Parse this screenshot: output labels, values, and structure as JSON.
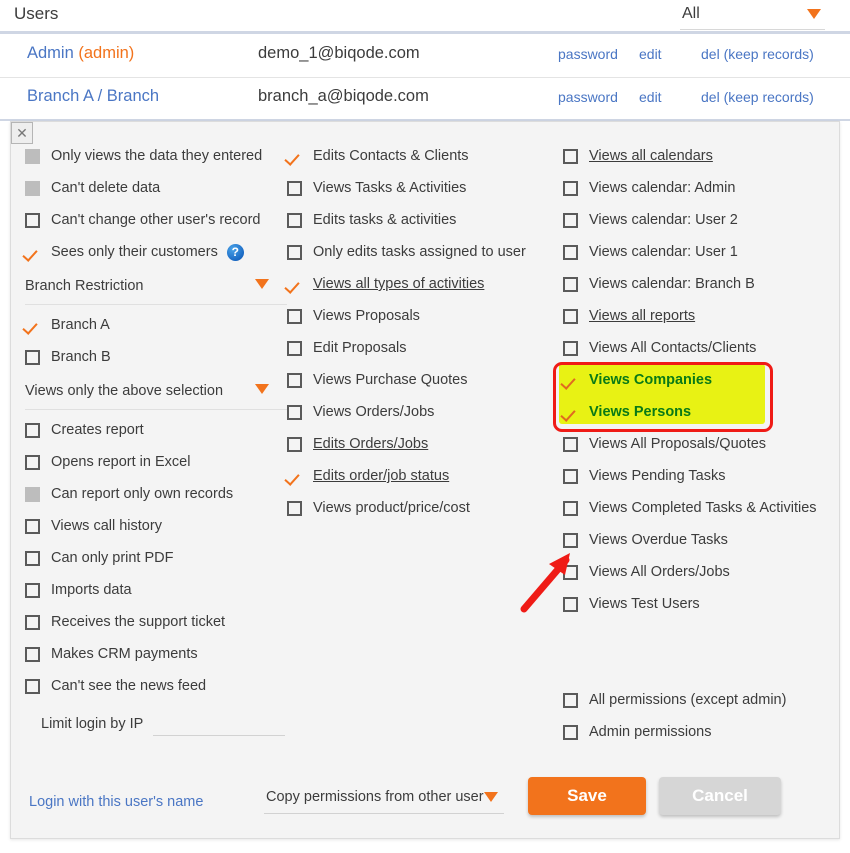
{
  "users_section": {
    "title": "Users",
    "filter": {
      "value": "All",
      "caret_icon": "caret-down-icon"
    },
    "rows": [
      {
        "name": "Admin ",
        "name_tag": "(admin)",
        "email": "demo_1@biqode.com",
        "actions": [
          "password",
          "edit",
          "del (keep records)"
        ]
      },
      {
        "name": "Branch A / Branch",
        "name_tag": "",
        "email": "branch_a@biqode.com",
        "actions": [
          "password",
          "edit",
          "del (keep records)"
        ]
      }
    ]
  },
  "permissions_panel": {
    "close_icon": "close-icon",
    "column1": [
      {
        "label": "Only views the data they entered",
        "state": "disabled"
      },
      {
        "label": "Can't delete data",
        "state": "disabled"
      },
      {
        "label": "Can't change other user's record",
        "state": "unchecked"
      },
      {
        "label": "Sees only their customers",
        "state": "checked",
        "help": "?"
      },
      {
        "label": "Branch Restriction",
        "state": "section"
      },
      {
        "label": "Branch A",
        "state": "checked"
      },
      {
        "label": "Branch B",
        "state": "unchecked"
      },
      {
        "label": "Views only the above selection",
        "state": "section"
      },
      {
        "label": "Creates report",
        "state": "unchecked"
      },
      {
        "label": "Opens report in Excel",
        "state": "unchecked"
      },
      {
        "label": "Can report only own records",
        "state": "disabled"
      },
      {
        "label": "Views call history",
        "state": "unchecked"
      },
      {
        "label": "Can only print PDF",
        "state": "unchecked"
      },
      {
        "label": "Imports data",
        "state": "unchecked"
      },
      {
        "label": "Receives the support ticket",
        "state": "unchecked"
      },
      {
        "label": "Makes CRM payments",
        "state": "unchecked"
      },
      {
        "label": "Can't see the news feed",
        "state": "unchecked"
      }
    ],
    "ip_limit": {
      "label": "Limit login by IP",
      "value": "",
      "placeholder": ""
    },
    "column2": [
      {
        "label": "Edits Contacts & Clients",
        "state": "checked"
      },
      {
        "label": "Views Tasks & Activities",
        "state": "unchecked"
      },
      {
        "label": "Edits tasks & activities",
        "state": "unchecked"
      },
      {
        "label": "Only edits tasks assigned to user",
        "state": "unchecked"
      },
      {
        "label": "Views all types of activities",
        "state": "checked",
        "link": true
      },
      {
        "label": "Views Proposals",
        "state": "unchecked"
      },
      {
        "label": "Edit Proposals",
        "state": "unchecked"
      },
      {
        "label": "Views Purchase Quotes",
        "state": "unchecked"
      },
      {
        "label": "Views Orders/Jobs",
        "state": "unchecked"
      },
      {
        "label": "Edits Orders/Jobs",
        "state": "unchecked",
        "link": true
      },
      {
        "label": "Edits order/job status",
        "state": "checked",
        "link": true
      },
      {
        "label": "Views product/price/cost",
        "state": "unchecked"
      }
    ],
    "column3": [
      {
        "label": "Views all calendars",
        "state": "unchecked",
        "link": true
      },
      {
        "label": "Views calendar: Admin",
        "state": "unchecked"
      },
      {
        "label": "Views calendar: User 2",
        "state": "unchecked"
      },
      {
        "label": "Views calendar: User 1",
        "state": "unchecked"
      },
      {
        "label": "Views calendar: Branch B",
        "state": "unchecked"
      },
      {
        "label": "Views all reports",
        "state": "unchecked",
        "link": true
      },
      {
        "label": "Views All Contacts/Clients",
        "state": "unchecked"
      },
      {
        "label": "Views Companies",
        "state": "checked",
        "highlighted": true
      },
      {
        "label": "Views Persons",
        "state": "checked",
        "highlighted": true
      },
      {
        "label": "Views All Proposals/Quotes",
        "state": "unchecked"
      },
      {
        "label": "Views Pending Tasks",
        "state": "unchecked"
      },
      {
        "label": "Views Completed Tasks & Activities",
        "state": "unchecked"
      },
      {
        "label": "Views Overdue Tasks",
        "state": "unchecked"
      },
      {
        "label": "Views All Orders/Jobs",
        "state": "unchecked"
      },
      {
        "label": "Views Test Users",
        "state": "unchecked"
      }
    ],
    "column3_bottom": [
      {
        "label": "All permissions (except admin)",
        "state": "unchecked"
      },
      {
        "label": "Admin permissions",
        "state": "unchecked"
      }
    ],
    "footer": {
      "login_as_link": "Login with this user's name",
      "copy_permissions": "Copy permissions from other user",
      "save_label": "Save",
      "cancel_label": "Cancel"
    },
    "annotations": {
      "highlight_color": "#e8f214",
      "highlight_border_color": "#ef1b16",
      "highlight_text_color": "#0a7a16",
      "arrow_color": "#ef1b16"
    }
  },
  "theme": {
    "accent": "#f2731c",
    "link": "#4a76c4",
    "panel_bg": "#f4f4f4",
    "text": "#3c3c3c"
  }
}
